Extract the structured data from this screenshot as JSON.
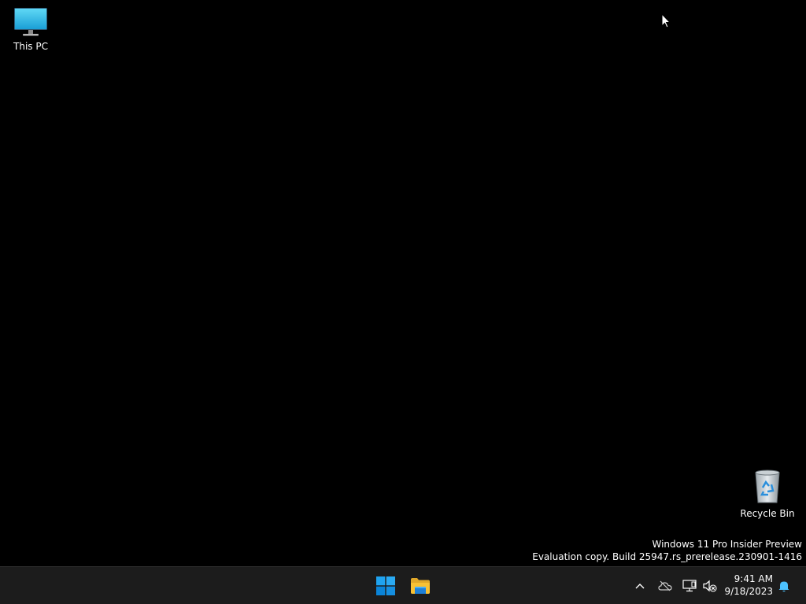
{
  "desktop": {
    "icons": [
      {
        "label": "This PC",
        "icon": "monitor-icon"
      },
      {
        "label": "Recycle Bin",
        "icon": "recycle-bin-icon"
      }
    ],
    "watermark": {
      "line1": "Windows 11 Pro Insider Preview",
      "line2": "Evaluation copy. Build 25947.rs_prerelease.230901-1416"
    }
  },
  "taskbar": {
    "pinned": [
      {
        "name": "Start",
        "icon": "windows-logo-icon"
      },
      {
        "name": "File Explorer",
        "icon": "folder-icon"
      }
    ],
    "tray": {
      "icons": [
        "chevron-up-icon",
        "onedrive-offline-icon",
        "network-icon",
        "volume-muted-icon",
        "notification-bell-icon"
      ],
      "time": "9:41 AM",
      "date": "9/18/2023"
    }
  },
  "colors": {
    "desktop_background": "#000000",
    "taskbar_background": "#1c1c1c",
    "accent": "#0078d4",
    "folder_yellow": "#f8c134",
    "notification_blue": "#4cc2ff"
  }
}
